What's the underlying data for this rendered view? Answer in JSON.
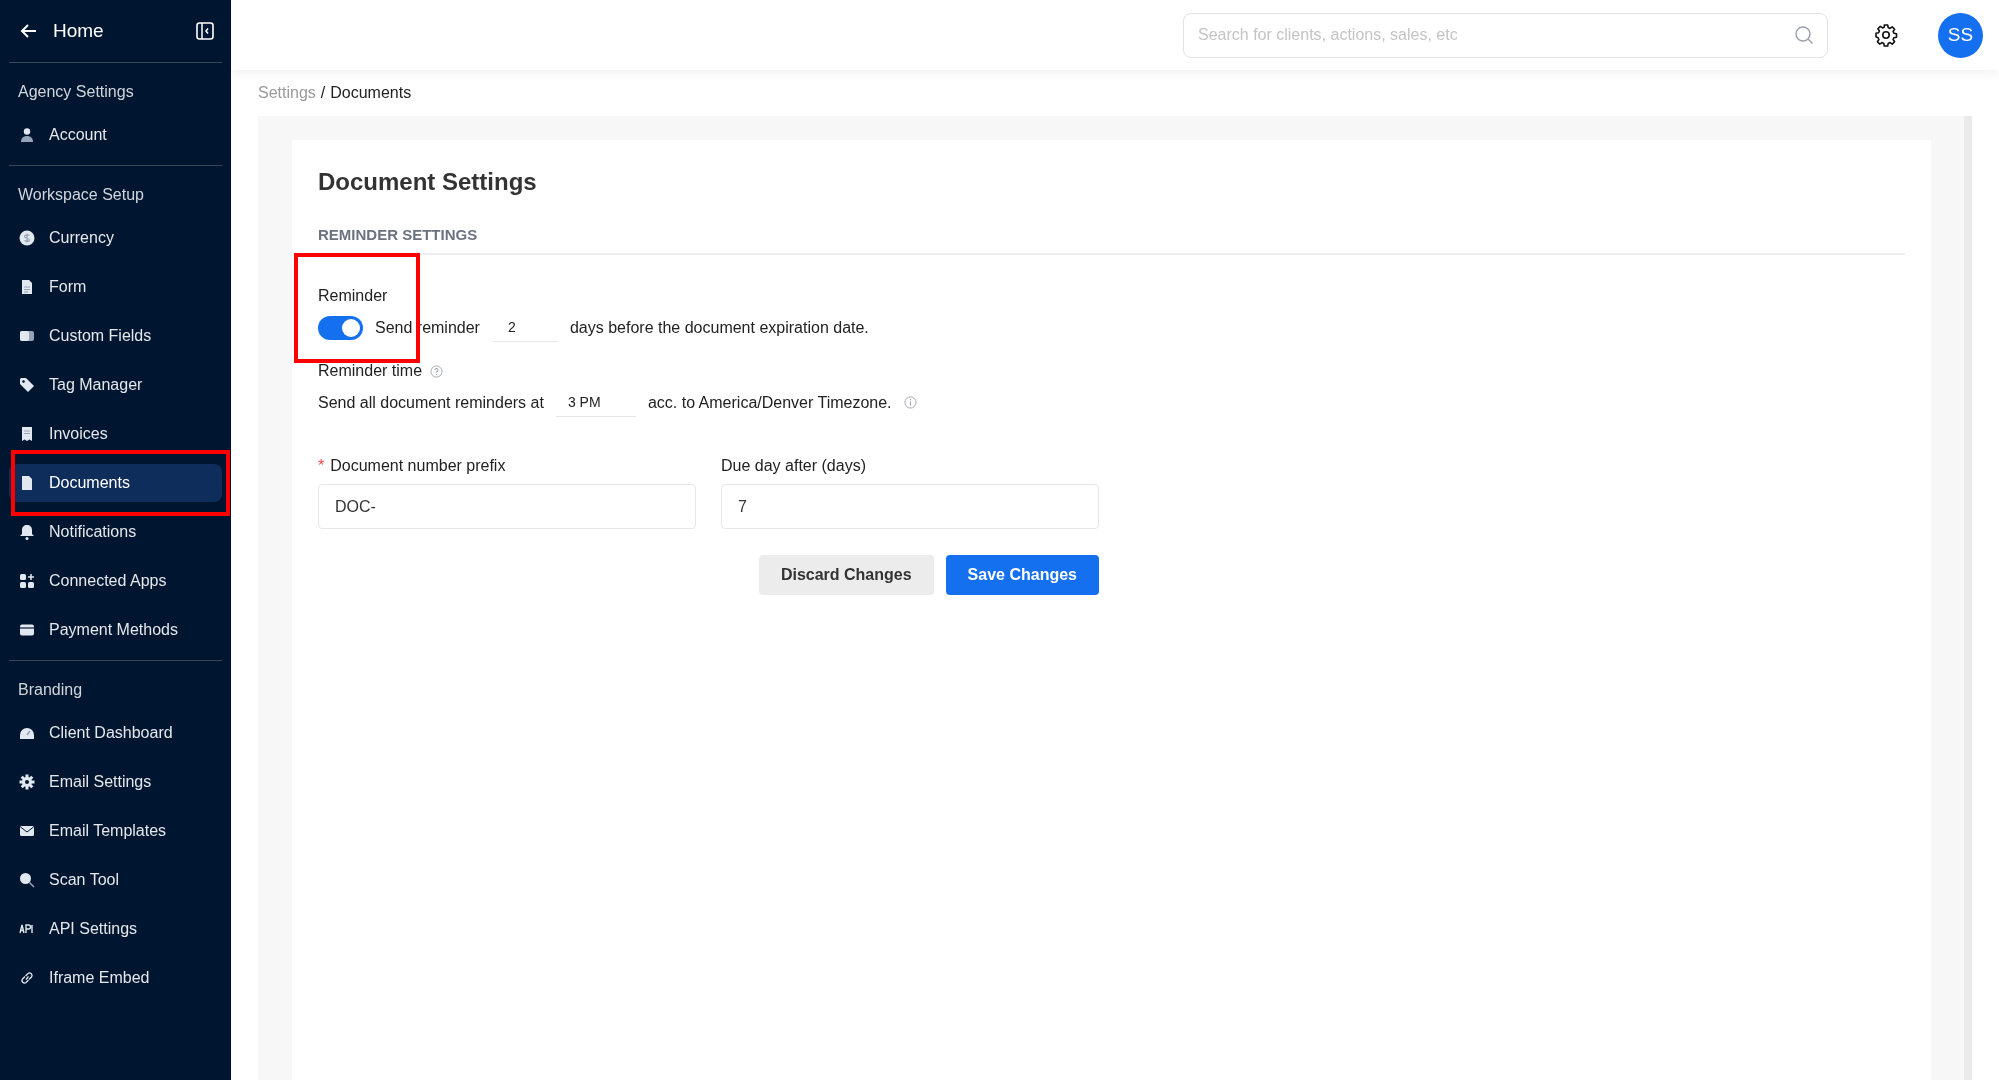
{
  "sidebar": {
    "home_label": "Home",
    "groups": [
      {
        "title": "Agency Settings",
        "items": [
          {
            "label": "Account",
            "selected": false,
            "highlighted": false
          }
        ]
      },
      {
        "title": "Workspace Setup",
        "items": [
          {
            "label": "Currency",
            "selected": false,
            "highlighted": false
          },
          {
            "label": "Form",
            "selected": false,
            "highlighted": false
          },
          {
            "label": "Custom Fields",
            "selected": false,
            "highlighted": false
          },
          {
            "label": "Tag Manager",
            "selected": false,
            "highlighted": false
          },
          {
            "label": "Invoices",
            "selected": false,
            "highlighted": false
          },
          {
            "label": "Documents",
            "selected": true,
            "highlighted": true
          },
          {
            "label": "Notifications",
            "selected": false,
            "highlighted": false
          },
          {
            "label": "Connected Apps",
            "selected": false,
            "highlighted": false
          },
          {
            "label": "Payment Methods",
            "selected": false,
            "highlighted": false
          }
        ]
      },
      {
        "title": "Branding",
        "items": [
          {
            "label": "Client Dashboard",
            "selected": false,
            "highlighted": false
          },
          {
            "label": "Email Settings",
            "selected": false,
            "highlighted": false
          },
          {
            "label": "Email Templates",
            "selected": false,
            "highlighted": false
          },
          {
            "label": "Scan Tool",
            "selected": false,
            "highlighted": false
          },
          {
            "label": "API Settings",
            "selected": false,
            "highlighted": false
          },
          {
            "label": "Iframe Embed",
            "selected": false,
            "highlighted": false
          }
        ]
      }
    ]
  },
  "topbar": {
    "search": {
      "placeholder": "Search for clients, actions, sales, etc"
    },
    "avatar": "SS"
  },
  "breadcrumb": [
    {
      "label": "Settings",
      "current": false
    },
    {
      "label": "Documents",
      "current": true
    }
  ],
  "breadcrumb_separator": "/",
  "page": {
    "title": "Document Settings",
    "section": "REMINDER SETTINGS",
    "reminder": {
      "label": "Reminder",
      "highlighted": true,
      "on": true,
      "text_before": "Send reminder",
      "days": "2",
      "text_after": "days before the document expiration date."
    },
    "reminder_time": {
      "label": "Reminder time",
      "text_before": "Send all document reminders at",
      "time": "3 PM",
      "text_after": "acc. to America/Denver Timezone."
    },
    "required_mark": "*",
    "fields": [
      {
        "label": "Document number prefix",
        "required": true,
        "value": "DOC-"
      },
      {
        "label": "Due day after (days)",
        "required": false,
        "value": "7"
      }
    ],
    "buttons": [
      {
        "label": "Discard Changes",
        "kind": "secondary"
      },
      {
        "label": "Save Changes",
        "kind": "primary"
      }
    ]
  }
}
